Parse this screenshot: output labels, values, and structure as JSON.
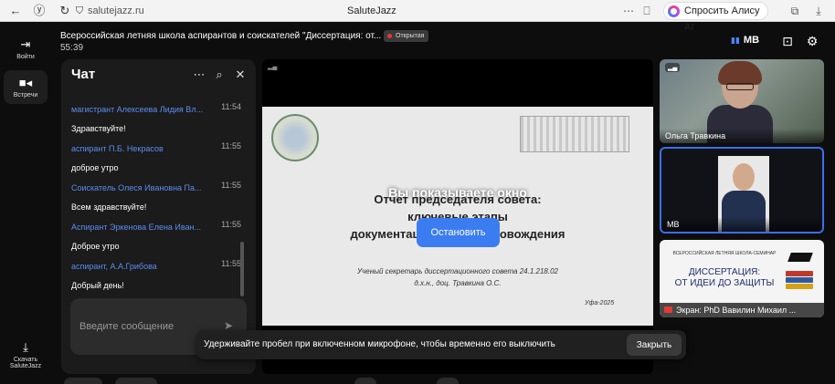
{
  "browser": {
    "url": "salutejazz.ru",
    "title": "SaluteJazz",
    "alice_label": "Спросить Алису AI"
  },
  "rail": {
    "login_label": "Войти",
    "meetings_label": "Встречи",
    "download_label_1": "Скачать",
    "download_label_2": "SaluteJazz"
  },
  "header": {
    "meeting_title": "Всероссийская летняя школа аспирантов и соискателей \"Диссертация: от...",
    "badge": "Открытая",
    "timer": "55:39",
    "speaker_initials": "МВ"
  },
  "chat": {
    "title": "Чат",
    "messages": [
      {
        "author": "магистрант Алексеева Лидия Вл...",
        "time": "11:54",
        "text": "Здравствуйте!"
      },
      {
        "author": "аспирант П.Б. Некрасов",
        "time": "11:55",
        "text": "доброе утро"
      },
      {
        "author": "Соискатель Олеся Ивановна Па...",
        "time": "11:55",
        "text": "Всем здравствуйте!"
      },
      {
        "author": "Аспирант Эркенова Елена Иван...",
        "time": "11:55",
        "text": "Доброе утро"
      },
      {
        "author": "аспирант, А.А.Грибова",
        "time": "11:55",
        "text": "Добрый день!"
      }
    ],
    "input_placeholder": "Введите сообщение"
  },
  "stage": {
    "slide_title_line1": "Отчет председателя совета:",
    "slide_title_line2": "ключевые этапы",
    "slide_title_line3": "документационного сопровождения",
    "slide_secretary_line1": "Ученый секретарь диссертационного совета 24.1.218.02",
    "slide_secretary_line2": "д.х.н., доц. Травкина О.С.",
    "slide_city": "Уфа-2025",
    "sharing_message": "Вы показываете окно",
    "stop_label": "Остановить"
  },
  "tiles": [
    {
      "name": "Ольга Травкина"
    },
    {
      "name": "МВ"
    },
    {
      "name": "Экран: PhD Вавилин Михаил ..."
    }
  ],
  "poster": {
    "top": "ВСЕРОССИЙСКАЯ ЛЕТНЯЯ ШКОЛА-СЕМИНАР",
    "main_line1": "ДИССЕРТАЦИЯ:",
    "main_line2": "ОТ ИДЕИ ДО ЗАЩИТЫ"
  },
  "toast": {
    "text": "Удерживайте пробел при включенном микрофоне, чтобы временно его выключить",
    "button": "Закрыть"
  },
  "colors": {
    "accent": "#3b7df0",
    "author": "#5b8def",
    "record": "#e53935"
  }
}
